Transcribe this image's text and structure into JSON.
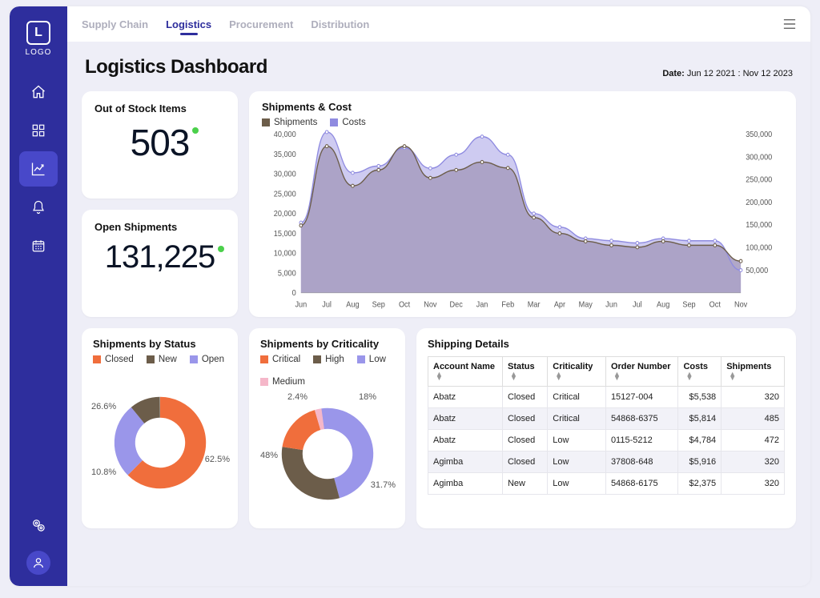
{
  "logo_text": "LOGO",
  "nav_tabs": [
    "Supply Chain",
    "Logistics",
    "Procurement",
    "Distribution"
  ],
  "active_tab_index": 1,
  "page_title": "Logistics Dashboard",
  "date_label": "Date:",
  "date_range": "Jun 12 2021 : Nov 12 2023",
  "kpi_out_of_stock": {
    "label": "Out of Stock Items",
    "value": "503"
  },
  "kpi_open_shipments": {
    "label": "Open Shipments",
    "value": "131,225"
  },
  "shipments_cost": {
    "title": "Shipments & Cost",
    "legend": [
      "Shipments",
      "Costs"
    ]
  },
  "chart_data": [
    {
      "type": "area",
      "title": "Shipments & Cost",
      "x": [
        "Jun",
        "Jul",
        "Aug",
        "Sep",
        "Oct",
        "Nov",
        "Dec",
        "Jan",
        "Feb",
        "Mar",
        "Apr",
        "May",
        "Jun",
        "Jul",
        "Aug",
        "Sep",
        "Oct",
        "Nov"
      ],
      "y_left_label": "Shipments",
      "y_right_label": "Costs",
      "y_left_ticks": [
        0,
        5000,
        10000,
        15000,
        20000,
        25000,
        30000,
        35000,
        40000
      ],
      "y_right_ticks": [
        50000,
        100000,
        150000,
        200000,
        250000,
        300000,
        350000
      ],
      "series": [
        {
          "name": "Shipments",
          "axis": "left",
          "color": "#6c5d4a",
          "values": [
            17000,
            37000,
            27000,
            31000,
            37000,
            29000,
            31000,
            33000,
            31500,
            19000,
            15000,
            13000,
            12000,
            11500,
            13000,
            12000,
            12000,
            8000
          ]
        },
        {
          "name": "Costs",
          "axis": "right",
          "color": "#8f8be0",
          "values": [
            155000,
            355000,
            265000,
            280000,
            320000,
            275000,
            305000,
            345000,
            305000,
            175000,
            145000,
            120000,
            115000,
            110000,
            120000,
            115000,
            115000,
            50000
          ]
        }
      ],
      "y_left_lim": [
        0,
        40000
      ],
      "y_right_lim": [
        0,
        350000
      ]
    },
    {
      "type": "pie",
      "title": "Shipments by Status",
      "series": [
        {
          "name": "Closed",
          "value": 62.5,
          "color": "#f06e3c"
        },
        {
          "name": "Open",
          "value": 26.6,
          "color": "#9a96ea"
        },
        {
          "name": "New",
          "value": 10.8,
          "color": "#6c5d4a"
        }
      ]
    },
    {
      "type": "pie",
      "title": "Shipments by Criticality",
      "series": [
        {
          "name": "Low",
          "value": 48.0,
          "color": "#9a96ea"
        },
        {
          "name": "High",
          "value": 31.7,
          "color": "#6c5d4a"
        },
        {
          "name": "Critical",
          "value": 18.0,
          "color": "#f06e3c"
        },
        {
          "name": "Medium",
          "value": 2.4,
          "color": "#f5b7c9"
        }
      ]
    }
  ],
  "status_card": {
    "title": "Shipments by Status",
    "legend": [
      "Closed",
      "New",
      "Open"
    ],
    "labels": {
      "closed": "62.5%",
      "open": "26.6%",
      "new": "10.8%"
    }
  },
  "criticality_card": {
    "title": "Shipments by Criticality",
    "legend": [
      "Critical",
      "High",
      "Low",
      "Medium"
    ],
    "labels": {
      "low": "48%",
      "high": "31.7%",
      "critical": "18%",
      "medium": "2.4%"
    }
  },
  "shipping_details": {
    "title": "Shipping Details",
    "columns": [
      "Account Name",
      "Status",
      "Criticality",
      "Order Number",
      "Costs",
      "Shipments"
    ],
    "rows": [
      [
        "Abatz",
        "Closed",
        "Critical",
        "15127-004",
        "$5,538",
        "320"
      ],
      [
        "Abatz",
        "Closed",
        "Critical",
        "54868-6375",
        "$5,814",
        "485"
      ],
      [
        "Abatz",
        "Closed",
        "Low",
        "0115-5212",
        "$4,784",
        "472"
      ],
      [
        "Agimba",
        "Closed",
        "Low",
        "37808-648",
        "$5,916",
        "320"
      ],
      [
        "Agimba",
        "New",
        "Low",
        "54868-6175",
        "$2,375",
        "320"
      ]
    ]
  },
  "colors": {
    "shipments": "#6c5d4a",
    "costs": "#8f8be0",
    "closed": "#f06e3c",
    "new": "#6c5d4a",
    "open": "#9a96ea",
    "critical": "#f06e3c",
    "high": "#6c5d4a",
    "low": "#9a96ea",
    "medium": "#f5b7c9"
  }
}
